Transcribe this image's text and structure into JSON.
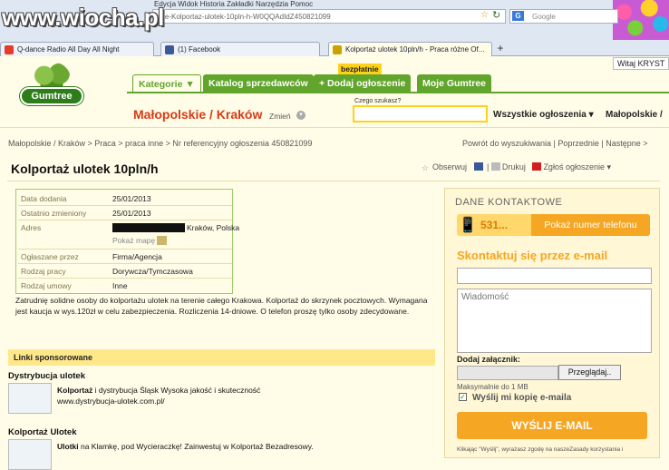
{
  "browser": {
    "watermark": "www.wiocha.pl",
    "menu": "Edycja  Widok  Historia  Zakładki  Narzędzia  Pomoc",
    "url": "nne-Kolportaz-ulotek-10pln-h-W0QQAdIdZ450821099",
    "search_placeholder": "Google",
    "search_engine_icon": "g-icon",
    "tabs": [
      {
        "label": "Q-dance Radio All Day All Night",
        "active": false,
        "color": "#e63a2a"
      },
      {
        "label": "(1) Facebook",
        "active": false,
        "color": "#3b5998"
      },
      {
        "label": "Kolportaż ulotek 10pln/h - Praca różne Of...",
        "active": true,
        "color": "#c9a200"
      }
    ],
    "new_tab": "+"
  },
  "header": {
    "login": "Witaj KRYST",
    "logo_text": "Gumtree",
    "nav": {
      "kategorie": "Kategorie ▼",
      "katalog": "Katalog sprzedawców",
      "dodaj": "+ Dodaj ogłoszenie",
      "moje": "Moje Gumtree",
      "badge": "bezpłatnie"
    },
    "location": "Małopolskie / Kraków",
    "change": "Zmień",
    "search_label": "Czego szukasz?",
    "search_value": "",
    "all_ads": "Wszystkie ogłoszenia ▾",
    "region": "Małopolskie /"
  },
  "breadcrumb": {
    "path": "Małopolskie / Kraków > Praca > praca inne > Nr referencyjny ogłoszenia 450821099",
    "back": "Powrót do wyszukiwania | Poprzednie | Następne >"
  },
  "listing": {
    "title": "Kolportaż ulotek 10pln/h",
    "actions": {
      "watch": "Obserwuj",
      "share": "|",
      "print": "Drukuj",
      "report": "Zgłoś ogłoszenie ▾"
    },
    "details": [
      {
        "label": "Data dodania",
        "value": "25/01/2013"
      },
      {
        "label": "Ostatnio zmieniony",
        "value": "25/01/2013"
      },
      {
        "label": "Adres",
        "value": "Kraków, Polska",
        "map_link": "Pokaż mapę"
      },
      {
        "label": "Ogłaszane przez",
        "value": "Firma/Agencja"
      },
      {
        "label": "Rodzaj pracy",
        "value": "Dorywcza/Tymczasowa"
      },
      {
        "label": "Rodzaj umowy",
        "value": "Inne"
      }
    ],
    "description": "Zatrudnię solidne osoby do kolportażu ulotek na terenie całego Krakowa. Kolportaż do skrzynek pocztowych. Wymagana jest kaucja w wys.120zł w celu zabezpieczenia. Rozliczenia 14-dniowe. O telefon proszę tylko osoby zdecydowane."
  },
  "sponsored": {
    "heading": "Linki sponsorowane",
    "ads": [
      {
        "title": "Dystrybucja ulotek",
        "bold": "Kolportaż",
        "text": " i dystrybucja Śląsk Wysoka jakość i skuteczność",
        "url": "www.dystrybucja-ulotek.com.pl/"
      },
      {
        "title": "Kolportaż Ulotek",
        "bold": "Ulotki",
        "text": " na Klamkę, pod Wycieraczkę! Zainwestuj w Kolportaż Bezadresowy.",
        "url": ""
      }
    ]
  },
  "contact": {
    "heading": "DANE KONTAKTOWE",
    "phone_prefix": "531...",
    "phone_button": "Pokaż numer telefonu",
    "email_heading": "Skontaktuj się przez e-mail",
    "email_value": "",
    "message_placeholder": "Wiadomość",
    "attach_label": "Dodaj załącznik:",
    "browse": "Przeglądaj..",
    "max_size": "Maksymalnie do 1 MB",
    "copy_label": "Wyślij mi kopię e-maila",
    "copy_checked": true,
    "send": "WYŚLIJ E-MAIL",
    "terms": "Klikając \"Wyślij\", wyrażasz zgodę na naszeZasady korzystania i"
  },
  "colors": {
    "green": "#62a52c",
    "orange": "#f5a623",
    "red_location": "#d93a16",
    "page_bg": "#fffde8"
  }
}
